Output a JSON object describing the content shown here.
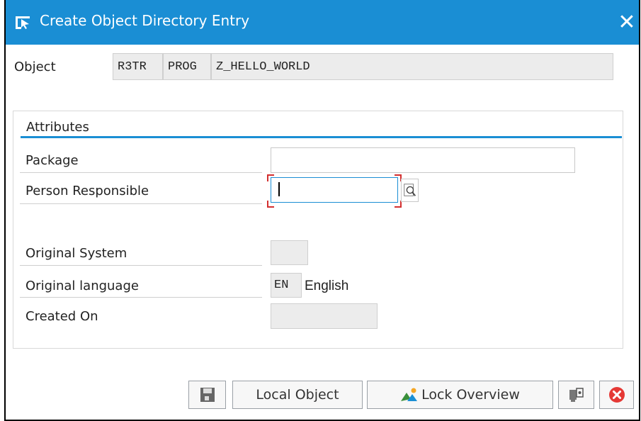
{
  "title": "Create Object Directory Entry",
  "object": {
    "label": "Object",
    "pgmid": "R3TR",
    "type": "PROG",
    "name": "Z_HELLO_WORLD"
  },
  "attributes": {
    "header": "Attributes",
    "package": {
      "label": "Package",
      "value": ""
    },
    "person_responsible": {
      "label": "Person Responsible",
      "value": ""
    },
    "original_system": {
      "label": "Original System",
      "value": ""
    },
    "original_language": {
      "label": "Original language",
      "code": "EN",
      "name": "English"
    },
    "created_on": {
      "label": "Created On",
      "value": ""
    }
  },
  "buttons": {
    "save": "save-icon",
    "local_object": "Local Object",
    "lock_overview": "Lock Overview",
    "help": "help-icon",
    "cancel": "cancel-icon"
  },
  "colors": {
    "titlebar": "#1a8ed4",
    "accent_line": "#1a8ed4",
    "focus_corner": "#d32f2f",
    "cancel": "#e53935"
  }
}
